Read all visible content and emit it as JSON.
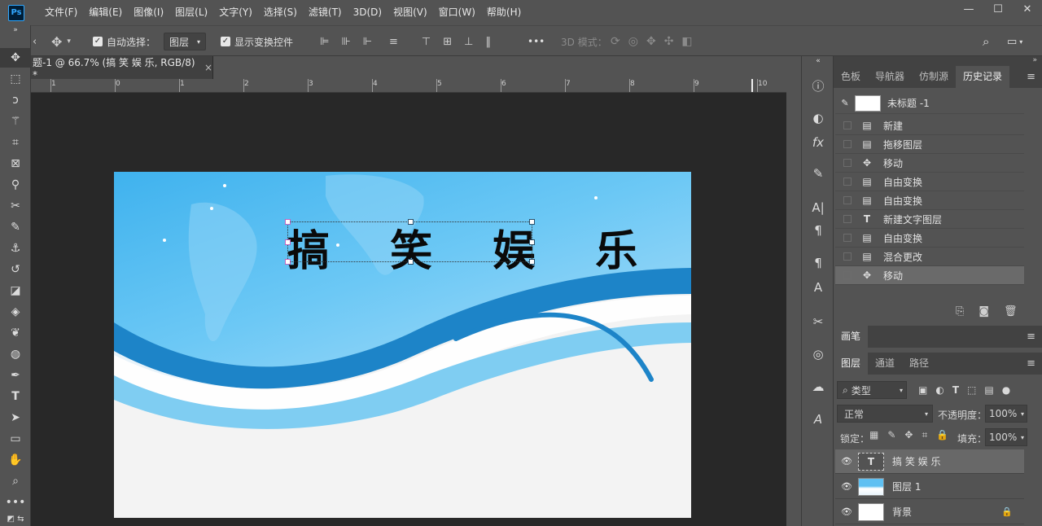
{
  "app": {
    "logo": "Ps"
  },
  "menu": [
    "文件(F)",
    "编辑(E)",
    "图像(I)",
    "图层(L)",
    "文字(Y)",
    "选择(S)",
    "滤镜(T)",
    "3D(D)",
    "视图(V)",
    "窗口(W)",
    "帮助(H)"
  ],
  "window_controls": {
    "minimize": "—",
    "maximize": "☐",
    "close": "✕"
  },
  "options": {
    "auto_select_label": "自动选择：",
    "auto_select_value": "图层",
    "show_transform_label": "显示变换控件",
    "mode3d_label": "3D 模式：",
    "more": "•••"
  },
  "tab": {
    "title": "题-1 @ 66.7% (搞 笑 娱 乐, RGB/8) *",
    "close": "×"
  },
  "ruler_labels": [
    "1",
    "0",
    "1",
    "2",
    "3",
    "4",
    "5",
    "6",
    "7",
    "8",
    "9",
    "10"
  ],
  "canvas": {
    "headline": "搞 笑 娱 乐"
  },
  "history_panel": {
    "tabs": [
      "色板",
      "导航器",
      "仿制源",
      "历史记录"
    ],
    "active_tab": "历史记录",
    "snapshot": "未标题 -1",
    "items": [
      {
        "icon": "doc-icon",
        "label": "新建"
      },
      {
        "icon": "doc-icon",
        "label": "拖移图层"
      },
      {
        "icon": "move-icon",
        "label": "移动"
      },
      {
        "icon": "doc-icon",
        "label": "自由变换"
      },
      {
        "icon": "doc-icon",
        "label": "自由变换"
      },
      {
        "icon": "type-icon",
        "label": "新建文字图层"
      },
      {
        "icon": "doc-icon",
        "label": "自由变换"
      },
      {
        "icon": "doc-icon",
        "label": "混合更改"
      },
      {
        "icon": "move-icon",
        "label": "移动"
      }
    ]
  },
  "brush_panel": {
    "title": "画笔"
  },
  "layers_panel": {
    "tabs": [
      "图层",
      "通道",
      "路径"
    ],
    "filter_label": "类型",
    "blend_mode": "正常",
    "opacity_label": "不透明度：",
    "opacity_value": "100%",
    "lock_label": "锁定：",
    "fill_label": "填充：",
    "fill_value": "100%",
    "layers": [
      {
        "name": "搞 笑 娱 乐",
        "type": "text"
      },
      {
        "name": "图层 1",
        "type": "image"
      },
      {
        "name": "背景",
        "type": "background"
      }
    ]
  },
  "colors": {
    "panel": "#535353",
    "dark": "#282828",
    "canvas_blue": "#5fc0f2",
    "selected_row": "#6a6a6a"
  }
}
